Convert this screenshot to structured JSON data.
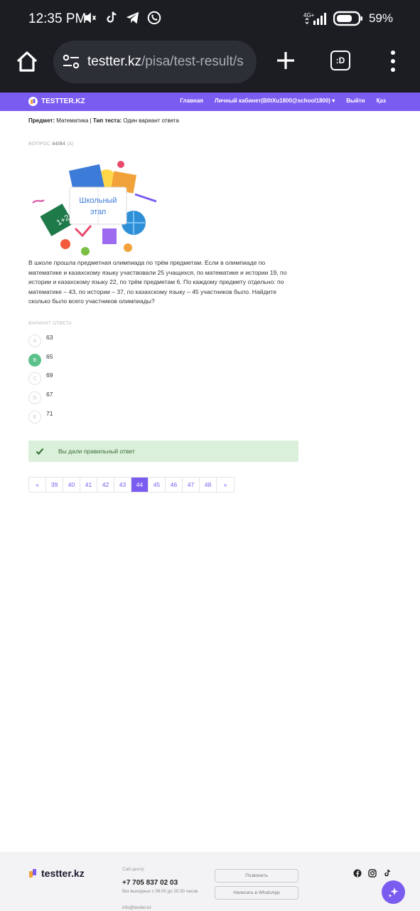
{
  "status": {
    "time": "12:35 PM",
    "battery": "59%",
    "network": "4G+"
  },
  "browser": {
    "url_host": "testter.kz",
    "url_path": "/pisa/test-result/s",
    "tabs_label": ":D"
  },
  "nav": {
    "brand": "TESTTER.KZ",
    "links": [
      "Главная",
      "Личный кабинет(B0tXu1800@school1800) ▾",
      "Выйти",
      "Қаз"
    ]
  },
  "meta": {
    "subject_label": "Предмет:",
    "subject_value": "Математика",
    "separator": "|",
    "type_label": "Тип теста:",
    "type_value": "Один вариант ответа"
  },
  "question": {
    "number_label": "ВОПРОС",
    "number": "44/84",
    "extra": "(A)",
    "image_caption": "Школьный этап",
    "text": "В школе прошла предметная олимпиада по трём предметам. Если в олимпиаде по математике и казахскому языку участвовали 25 учащихся, по математике и истории 19, по истории и казахскому языку 22, по трём предметам 6. По каждому предмету отдельно: по математике – 43, по истории – 37, по казахскому языку – 45 участников было. Найдите сколько было всего участников олимпиады?"
  },
  "answers": {
    "label": "ВАРИАНТ ОТВЕТА",
    "options": [
      {
        "letter": "A",
        "value": "63",
        "correct": false
      },
      {
        "letter": "B",
        "value": "65",
        "correct": true
      },
      {
        "letter": "C",
        "value": "69",
        "correct": false
      },
      {
        "letter": "D",
        "value": "67",
        "correct": false
      },
      {
        "letter": "E",
        "value": "71",
        "correct": false
      }
    ]
  },
  "result": {
    "message": "Вы дали правильный ответ"
  },
  "pagination": {
    "prev": "«",
    "pages": [
      "39",
      "40",
      "41",
      "42",
      "43",
      "44",
      "45",
      "46",
      "47",
      "48"
    ],
    "active": "44",
    "next": "»"
  },
  "footer": {
    "brand": "testter.kz",
    "call_label": "Call-центр",
    "phone": "+7 705 837 02 03",
    "hours": "без выходных с 08:00 до 20:30 часов",
    "email": "info@testter.kz",
    "call_button": "Позвонить",
    "whatsapp_button": "Написать в WhatsApp"
  },
  "colors": {
    "accent": "#7b5cf0",
    "correct": "#5cc28a",
    "success_bg": "#dbf0db"
  }
}
